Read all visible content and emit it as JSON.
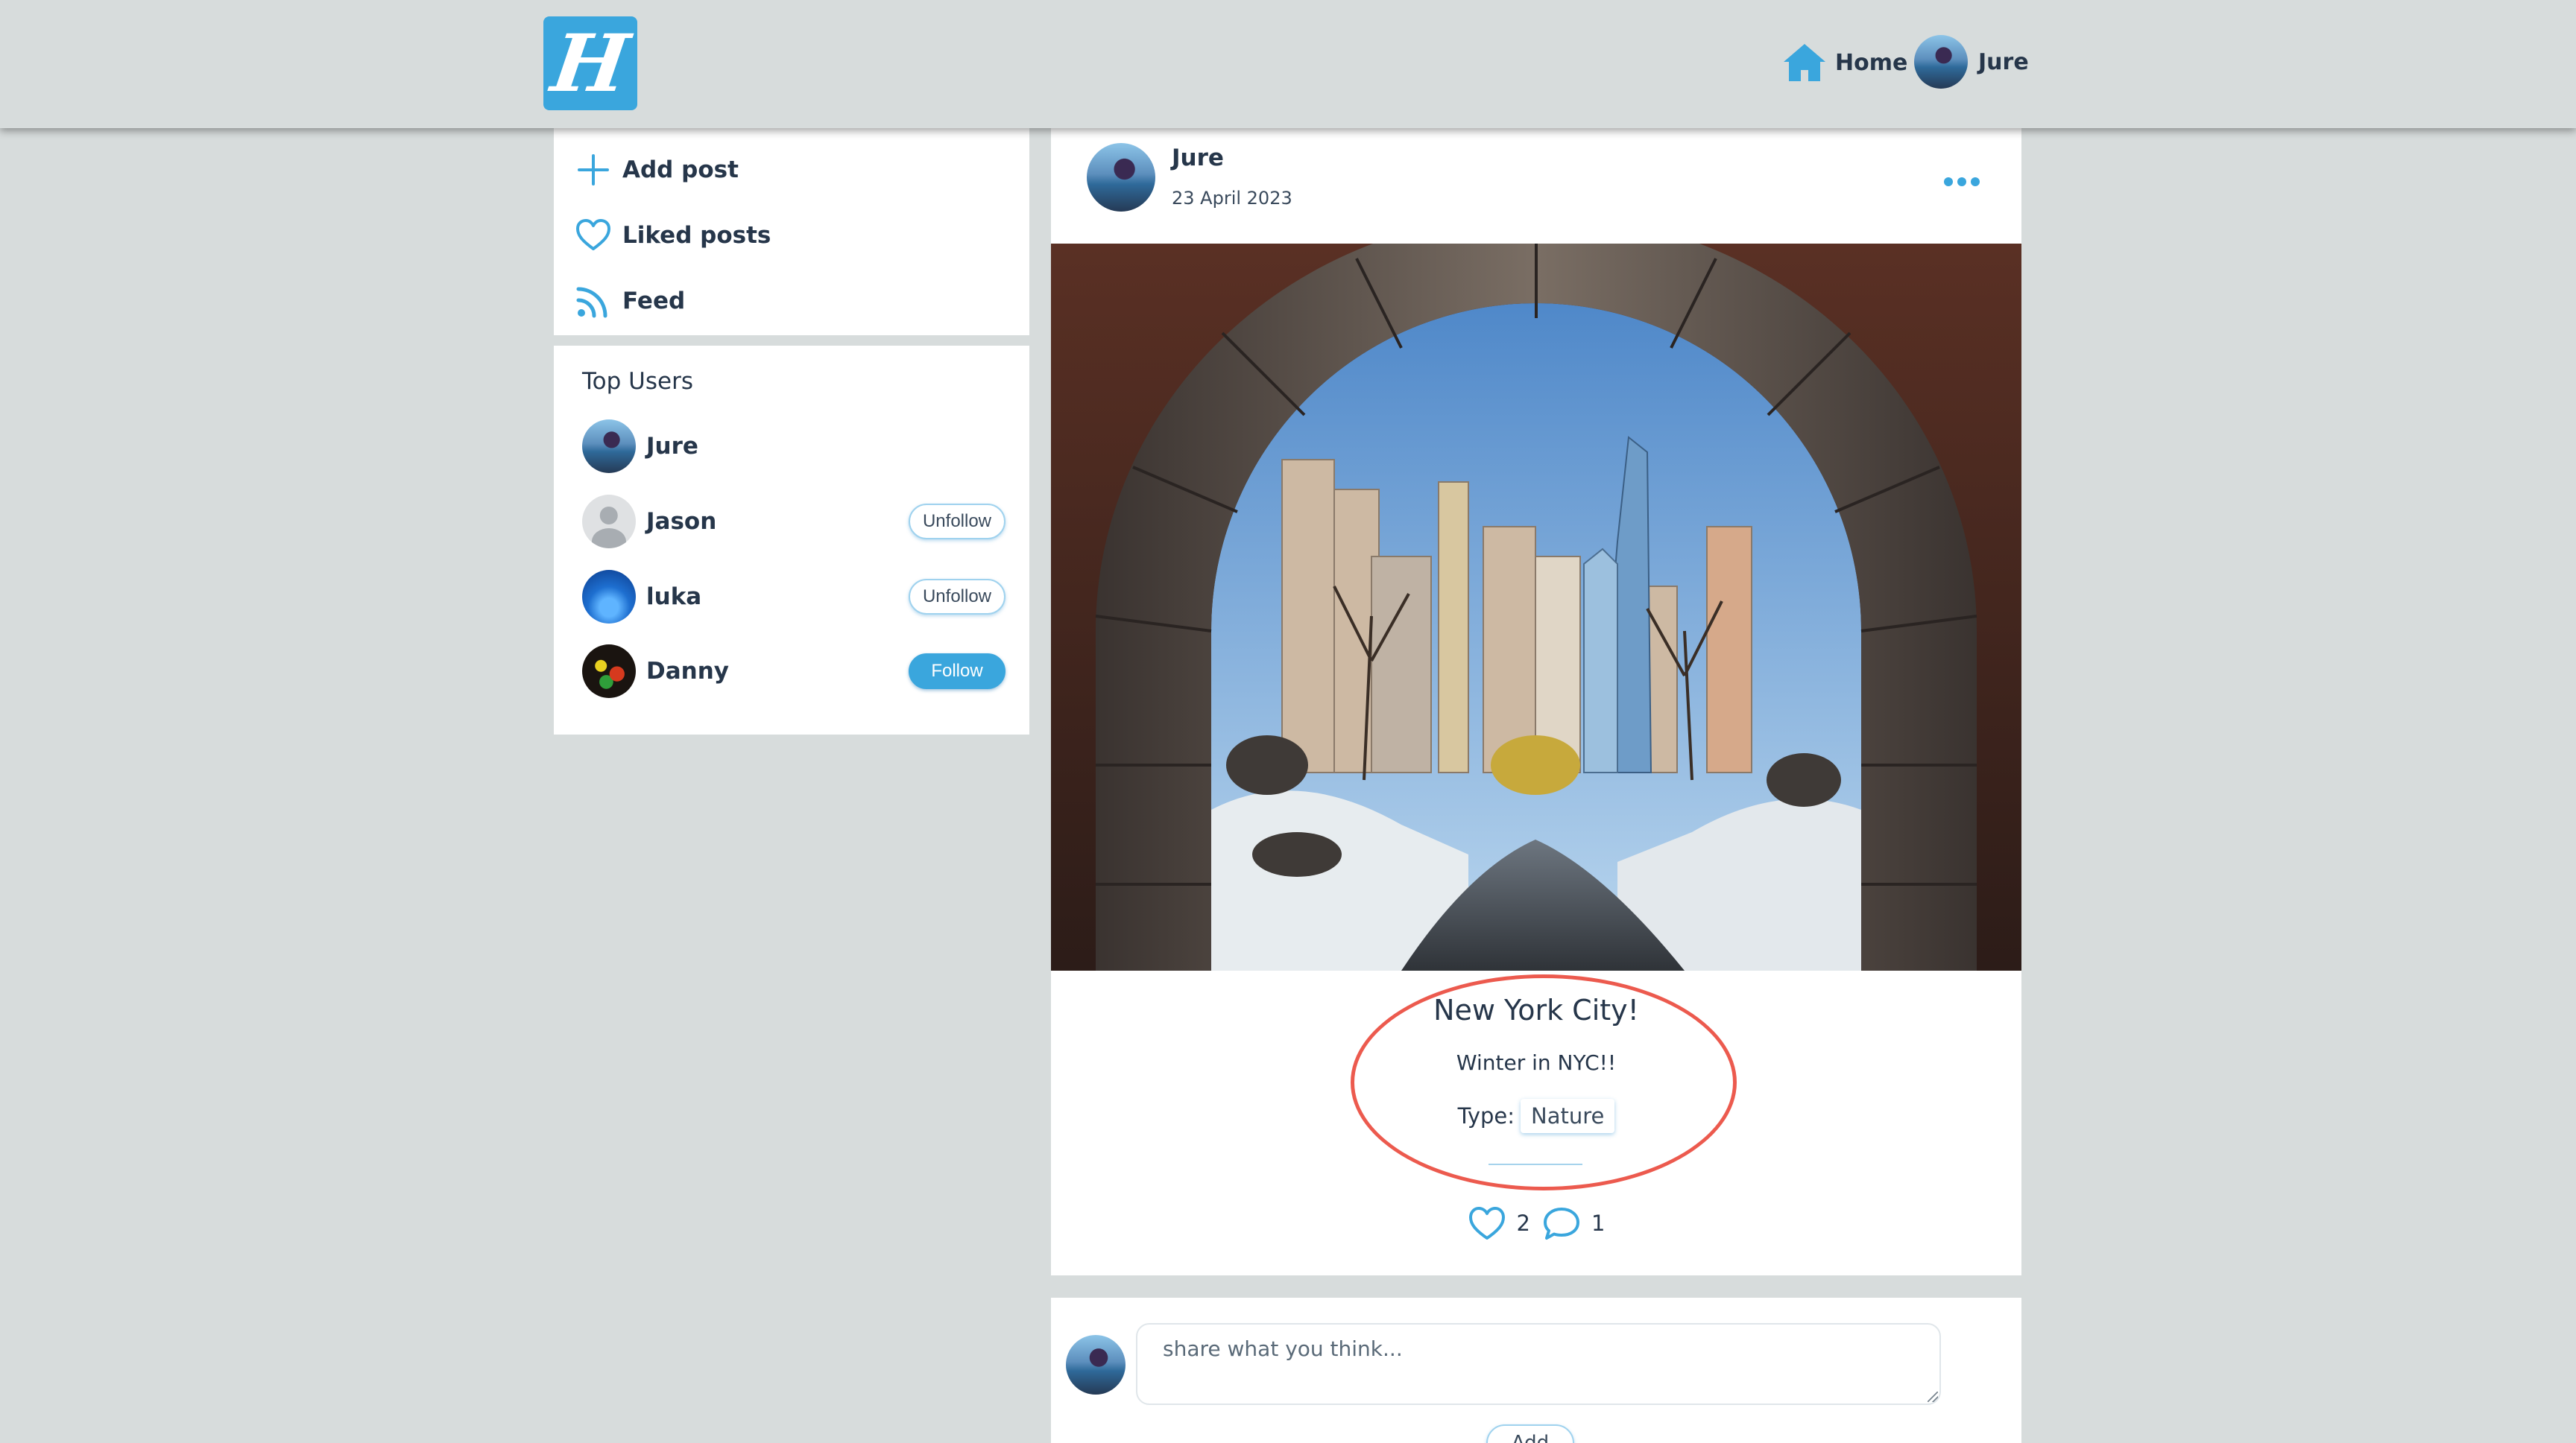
{
  "header": {
    "logo_letter": "H",
    "nav_home_label": "Home",
    "nav_user_label": "Jure"
  },
  "sidebar": {
    "menu": [
      {
        "label": "Add post",
        "icon": "plus-icon"
      },
      {
        "label": "Liked posts",
        "icon": "heart-icon"
      },
      {
        "label": "Feed",
        "icon": "rss-icon"
      }
    ],
    "top_users_title": "Top Users",
    "top_users": [
      {
        "name": "Jure",
        "action": ""
      },
      {
        "name": "Jason",
        "action": "Unfollow"
      },
      {
        "name": "luka",
        "action": "Unfollow"
      },
      {
        "name": "Danny",
        "action": "Follow"
      }
    ]
  },
  "post": {
    "author": "Jure",
    "date": "23 April 2023",
    "title": "New York City!",
    "description": "Winter in NYC!!",
    "type_label": "Type:",
    "type_value": "Nature",
    "likes": "2",
    "comments": "1"
  },
  "comment_box": {
    "placeholder": "share what you think...",
    "add_label": "Add"
  },
  "colors": {
    "accent": "#3aa6dd",
    "background": "#d7dcdc",
    "annotation": "#ec5a4e"
  }
}
